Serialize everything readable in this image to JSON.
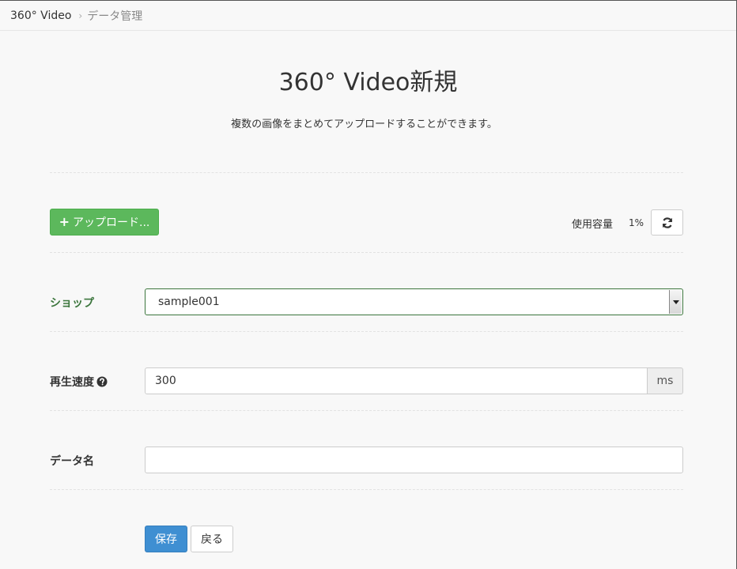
{
  "breadcrumb": {
    "root": "360° Video",
    "separator": "›",
    "current": "データ管理"
  },
  "page": {
    "title": "360° Video新規",
    "description": "複数の画像をまとめてアップロードすることができます。"
  },
  "upload": {
    "icon": "plus-icon",
    "plus_glyph": "+",
    "label": "アップロード..."
  },
  "usage": {
    "label": "使用容量",
    "value": "1%",
    "refresh_icon": "refresh-icon"
  },
  "form": {
    "shop": {
      "label": "ショップ",
      "selected": "sample001"
    },
    "speed": {
      "label": "再生速度",
      "help_icon": "question-circle-icon",
      "value": "300",
      "unit": "ms"
    },
    "name": {
      "label": "データ名",
      "value": ""
    }
  },
  "actions": {
    "save_label": "保存",
    "back_label": "戻る"
  },
  "colors": {
    "success": "#5cb85c",
    "primary": "#3f8fd2",
    "shop_label": "#3c763d"
  }
}
